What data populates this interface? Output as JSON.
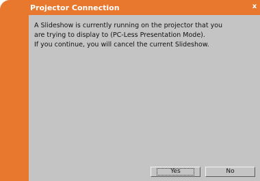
{
  "window": {
    "title": "Projector Connection",
    "close_label": "x"
  },
  "message": {
    "lines": [
      "A Slideshow is currently running on the projector that you",
      "are trying to display to (PC-Less Presentation Mode).",
      "If you continue, you will cancel the current Slideshow."
    ]
  },
  "buttons": {
    "yes_label": "Yes",
    "no_label": "No"
  },
  "colors": {
    "title_bar": "#e8782e",
    "content_bg": "#c4c4c4"
  }
}
